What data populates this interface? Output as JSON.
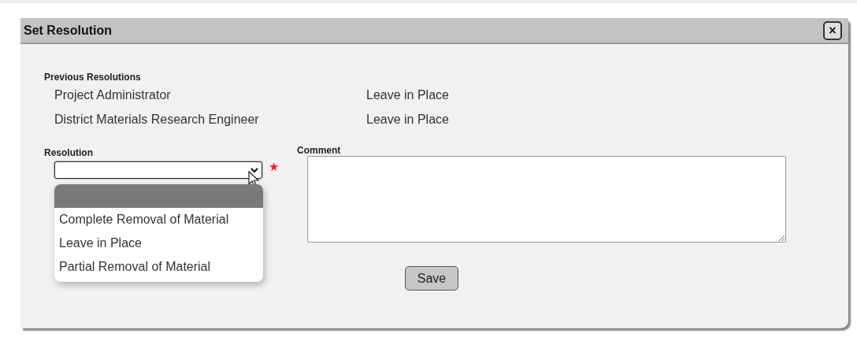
{
  "dialog": {
    "title": "Set Resolution",
    "close_label": "×"
  },
  "previous_resolutions": {
    "label": "Previous Resolutions",
    "rows": [
      {
        "role": "Project Administrator",
        "resolution": "Leave in Place"
      },
      {
        "role": "District Materials Research Engineer",
        "resolution": "Leave in Place"
      }
    ]
  },
  "resolution": {
    "label": "Resolution",
    "required_mark": "★",
    "expanded": true,
    "options": [
      {
        "selected": true
      },
      {
        "label": "Complete Removal of Material",
        "selected": false
      },
      {
        "label": "Leave in Place",
        "selected": false
      },
      {
        "label": "Partial Removal of Material",
        "selected": false
      }
    ]
  },
  "comment": {
    "label": "Comment"
  },
  "buttons": [
    "Save"
  ]
}
